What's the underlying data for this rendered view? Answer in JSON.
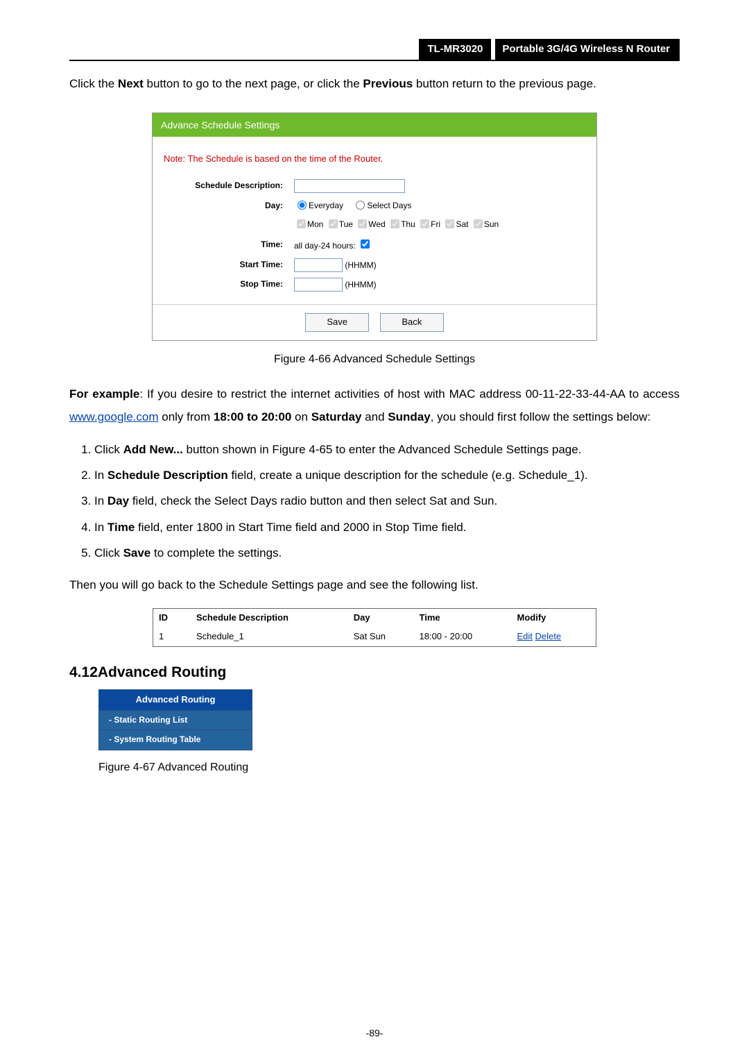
{
  "header": {
    "model": "TL-MR3020",
    "product": "Portable 3G/4G Wireless N Router"
  },
  "intro": {
    "prefix": "Click the ",
    "next_b": "Next",
    "mid": " button to go to the next page, or click the ",
    "prev_b": "Previous",
    "suffix": " button return to the previous page."
  },
  "panel": {
    "title": "Advance Schedule Settings",
    "note": "Note: The Schedule is based on the time of the Router.",
    "labels": {
      "desc": "Schedule Description:",
      "day": "Day:",
      "time": "Time:",
      "start": "Start Time:",
      "stop": "Stop Time:"
    },
    "radio_everyday": "Everyday",
    "radio_select": "Select Days",
    "days": [
      "Mon",
      "Tue",
      "Wed",
      "Thu",
      "Fri",
      "Sat",
      "Sun"
    ],
    "time_label": "all day-24 hours:",
    "hhmm": "(HHMM)",
    "save": "Save",
    "back": "Back"
  },
  "fig66": "Figure 4-66    Advanced Schedule Settings",
  "example": {
    "lead_b": "For example",
    "p1a": ": If you desire to restrict the internet activities of host with MAC address 00-11-22-33-44-AA to access ",
    "link": "www.google.com",
    "p1b": " only from ",
    "t_b": "18:00 to 20:00",
    "p1c": " on ",
    "sat_b": "Saturday",
    "p1d": " and ",
    "sun_b": "Sunday",
    "p1e": ", you should first follow the settings below:"
  },
  "steps": {
    "s1a": "Click ",
    "s1b": "Add New...",
    "s1c": " button shown in Figure 4-65 to enter the Advanced Schedule Settings page.",
    "s2a": "In ",
    "s2b": "Schedule Description",
    "s2c": " field, create a unique description for the schedule (e.g. Schedule_1).",
    "s3a": "In ",
    "s3b": "Day",
    "s3c": " field, check the Select Days radio button and then select Sat and Sun.",
    "s4a": "In ",
    "s4b": "Time",
    "s4c": " field, enter 1800 in Start Time field and 2000 in Stop Time field.",
    "s5a": "Click ",
    "s5b": "Save",
    "s5c": " to complete the settings."
  },
  "then_line": "Then you will go back to the Schedule Settings page and see the following list.",
  "table": {
    "headers": [
      "ID",
      "Schedule Description",
      "Day",
      "Time",
      "Modify"
    ],
    "row": {
      "id": "1",
      "desc": "Schedule_1",
      "day": "Sat  Sun",
      "time": "18:00 - 20:00",
      "edit": "Edit",
      "delete": "Delete"
    }
  },
  "section412": {
    "num": "4.12",
    "title": "Advanced Routing"
  },
  "nav": {
    "head": "Advanced Routing",
    "items": [
      "Static Routing List",
      "System Routing Table"
    ]
  },
  "fig67": "Figure 4-67 Advanced Routing",
  "page_no": "-89-"
}
